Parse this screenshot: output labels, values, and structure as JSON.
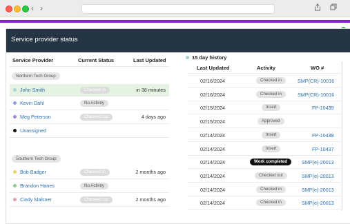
{
  "browser": {
    "back": "‹",
    "forward": "›"
  },
  "panel_title": "Service provider status",
  "left_headers": {
    "provider": "Service Provider",
    "status": "Current Status",
    "updated": "Last Updated"
  },
  "groups": [
    {
      "name": "Northern Tech Group",
      "rows": [
        {
          "name": "John Smith",
          "status": "Checked in",
          "style": "ghost",
          "updated": "in 38 minutes",
          "dot": "#a5d6d3",
          "highlight": true
        },
        {
          "name": "Kevin Dahl",
          "status": "No Activity",
          "style": "gray",
          "updated": "",
          "dot": "#8c9dd8",
          "highlight": false
        },
        {
          "name": "Meg Peterson",
          "status": "Checked out",
          "style": "ghost",
          "updated": "4 days ago",
          "dot": "#9b88d8",
          "highlight": false
        },
        {
          "name": "Unassigned",
          "status": "",
          "style": "",
          "updated": "",
          "dot": "#111111",
          "highlight": false
        }
      ]
    },
    {
      "name": "Southern Tech Group",
      "rows": [
        {
          "name": "Bob Badger",
          "status": "Checked in",
          "style": "ghost",
          "updated": "2 months ago",
          "dot": "#e7d06a",
          "highlight": false
        },
        {
          "name": "Brandon Hanes",
          "status": "No Activity",
          "style": "gray",
          "updated": "",
          "dot": "#8fc98a",
          "highlight": false
        },
        {
          "name": "Cindy Malsner",
          "status": "Checked out",
          "style": "ghost",
          "updated": "2 months ago",
          "dot": "#e39bb6",
          "highlight": false
        }
      ]
    }
  ],
  "history_title": "15 day history",
  "history_dot": "#a5d6d3",
  "right_headers": {
    "updated": "Last Updated",
    "activity": "Activity",
    "wo": "WO #"
  },
  "history": [
    {
      "date": "02/16/2024",
      "activity": "Checked in",
      "style": "gray",
      "wo": "SMP(CR)-10016"
    },
    {
      "date": "02/16/2024",
      "activity": "Checked in",
      "style": "gray",
      "wo": "SMP(CR)-10016"
    },
    {
      "date": "02/15/2024",
      "activity": "Insert",
      "style": "gray",
      "wo": "FP-10439"
    },
    {
      "date": "02/15/2024",
      "activity": "Approved",
      "style": "gray",
      "wo": ""
    },
    {
      "date": "02/14/2024",
      "activity": "Insert",
      "style": "gray",
      "wo": "FP-10438"
    },
    {
      "date": "02/14/2024",
      "activity": "Insert",
      "style": "gray",
      "wo": "FP-10437"
    },
    {
      "date": "02/14/2024",
      "activity": "Work completed",
      "style": "dark",
      "wo": "SMP(e)-20013"
    },
    {
      "date": "02/14/2024",
      "activity": "Checked out",
      "style": "gray",
      "wo": "SMP(e)-20013"
    },
    {
      "date": "02/14/2024",
      "activity": "Checked in",
      "style": "gray",
      "wo": "SMP(e)-20013"
    },
    {
      "date": "02/14/2024",
      "activity": "Checked in",
      "style": "gray",
      "wo": "SMP(e)-20013"
    }
  ]
}
